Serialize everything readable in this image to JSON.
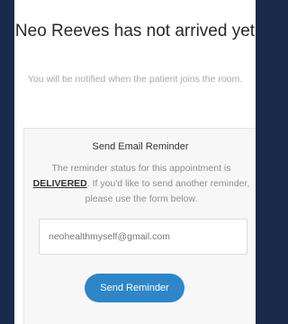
{
  "waiting_panel": {
    "title": "Neo Reeves has not arrived yet",
    "subtitle": "You will be notified when the patient joins the room."
  },
  "email_reminder": {
    "heading": "Send Email Reminder",
    "description_prefix": "The reminder status for this appointment is",
    "status": "DELIVERED",
    "description_suffix": ". If you'd like to send another reminder, please use the form below.",
    "email_value": "neohealthmyself@gmail.com",
    "send_label": "Send Reminder"
  },
  "colors": {
    "accent": "#2e86c9",
    "backdrop": "#1a2a4a"
  }
}
